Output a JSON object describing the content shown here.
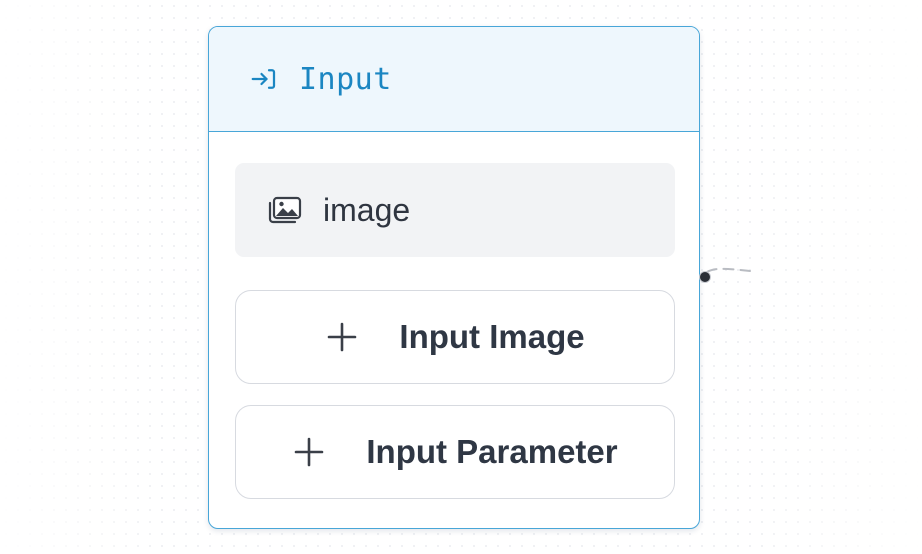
{
  "node": {
    "title": "Input",
    "title_icon": "input-arrow-icon",
    "fields": [
      {
        "label": "image",
        "icon": "image-stack-icon"
      }
    ],
    "buttons": [
      {
        "label": "Input Image",
        "icon": "plus-icon"
      },
      {
        "label": "Input Parameter",
        "icon": "plus-icon"
      }
    ]
  },
  "colors": {
    "accent": "#1b86c2",
    "border": "#48a6d8",
    "header_bg": "#eef7fd",
    "chip_bg": "#f2f3f5",
    "text": "#2f3744"
  }
}
